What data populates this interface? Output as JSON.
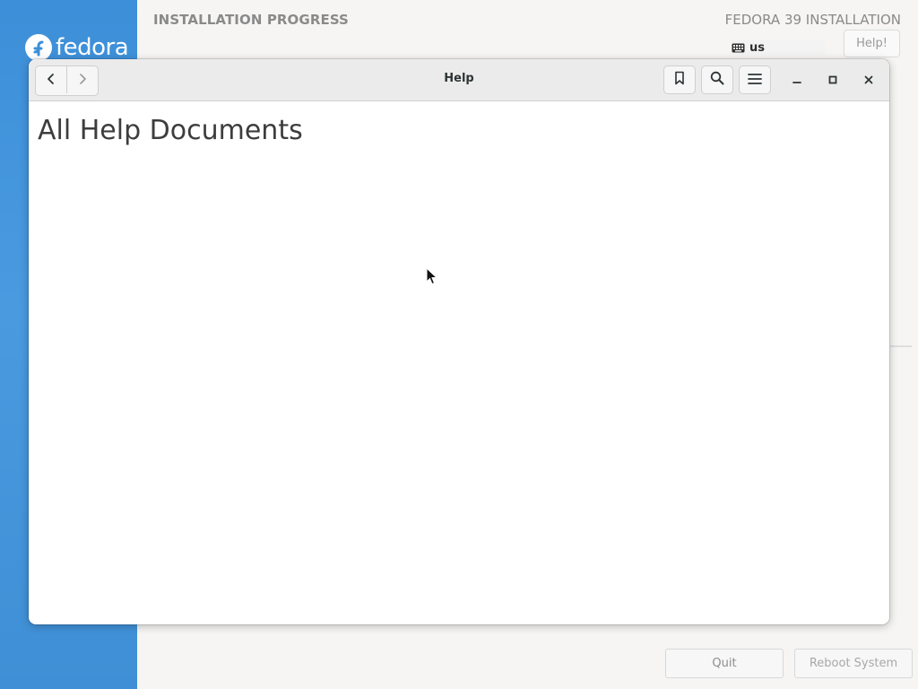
{
  "installer": {
    "logo_text": "fedora",
    "title": "INSTALLATION PROGRESS",
    "product": "FEDORA 39 INSTALLATION",
    "keyboard_layout": "us",
    "help_button": "Help!",
    "quit_button": "Quit",
    "reboot_button": "Reboot System"
  },
  "help_window": {
    "title": "Help",
    "heading": "All Help Documents",
    "icons": {
      "back": "chevron-left-icon",
      "forward": "chevron-right-icon",
      "bookmark": "bookmark-icon",
      "search": "search-icon",
      "menu": "hamburger-menu-icon",
      "minimize": "minimize-icon",
      "maximize": "maximize-icon",
      "close": "close-icon"
    }
  },
  "colors": {
    "sidebar_blue": "#3c8fd8",
    "headerbar": "#ebebeb",
    "content_bg": "#ffffff"
  }
}
